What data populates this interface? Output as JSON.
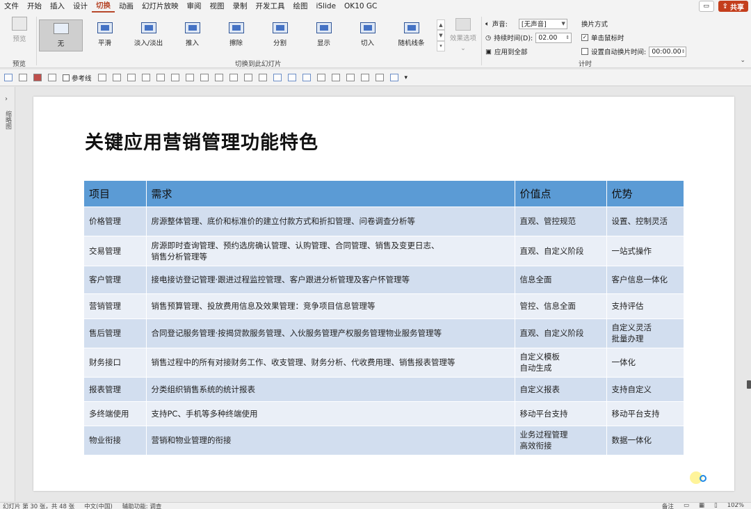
{
  "tabs": [
    "文件",
    "开始",
    "插入",
    "设计",
    "切换",
    "动画",
    "幻灯片放映",
    "审阅",
    "视图",
    "录制",
    "开发工具",
    "绘图",
    "iSlide",
    "OK10 GC"
  ],
  "active_tab": "切换",
  "share_label": "共享",
  "ribbon": {
    "preview_label": "预览",
    "preview_group": "预览",
    "transitions": [
      "无",
      "平滑",
      "淡入/淡出",
      "推入",
      "擦除",
      "分割",
      "显示",
      "切入",
      "随机线条"
    ],
    "selected_transition": "无",
    "transitions_group": "切换到此幻灯片",
    "effect_options": "效果选项",
    "sound_label": "声音:",
    "sound_value": "[无声音]",
    "duration_label": "持续时间(D):",
    "duration_value": "02.00",
    "apply_all": "应用到全部",
    "advance_title": "换片方式",
    "on_click": "单击鼠标时",
    "after_label": "设置自动换片时间:",
    "after_value": "00:00.00",
    "timing_group": "计时"
  },
  "qbar": {
    "guides_label": "参考线"
  },
  "left_pane_label": "缩略图",
  "slide": {
    "title": "关键应用营销管理功能特色",
    "headers": [
      "项目",
      "需求",
      "价值点",
      "优势"
    ],
    "rows": [
      [
        "价格管理",
        "房源整体管理、底价和标准价的建立付款方式和折扣管理、问卷调查分析等",
        "直观、管控规范",
        "设置、控制灵活"
      ],
      [
        "交易管理",
        "房源即时查询管理、预约选房确认管理、认购管理、合同管理、销售及变更日志、\n销售分析管理等",
        "直观、自定义阶段",
        "一站式操作"
      ],
      [
        "客户管理",
        "接电接访登记管理·跟进过程监控管理、客户跟进分析管理及客户怀管理等",
        "信息全面",
        "客户信息一体化"
      ],
      [
        "营销管理",
        "销售预算管理、投放费用信息及效果管理：竞争项目信息管理等",
        "管控、信息全面",
        "支持评估"
      ],
      [
        "售后管理",
        "合同登记服务管理·按揭贷款服务管理、入伙服务管理产权服务管理物业服务管理等",
        "直观、自定义阶段",
        "自定义灵活\n批量办理"
      ],
      [
        "财务接口",
        "销售过程中的所有对接财务工作、收支管理、财务分析、代收费用理、销售报表管理等",
        "自定义模板\n自动生成",
        "一体化"
      ],
      [
        "报表管理",
        "分类组织销售系统的统计报表",
        "自定义报表",
        "支持自定义"
      ],
      [
        "多终端使用",
        "支持PC、手机等多种终端使用",
        "移动平台支持",
        "移动平台支持"
      ],
      [
        "物业衔接",
        "营销和物业管理的衔接",
        "业务过程管理\n高效衔接",
        "数据一体化"
      ]
    ]
  },
  "status": {
    "slide_info": "幻灯片 第 30 张，共 48 张",
    "language": "中文(中国)",
    "accessibility": "辅助功能: 调查",
    "notes": "备注",
    "zoom": "102%"
  },
  "colors": {
    "header_blue": "#5b9bd5",
    "row_dark": "#d2deef",
    "row_light": "#eaeff7",
    "accent": "#b7472a"
  }
}
